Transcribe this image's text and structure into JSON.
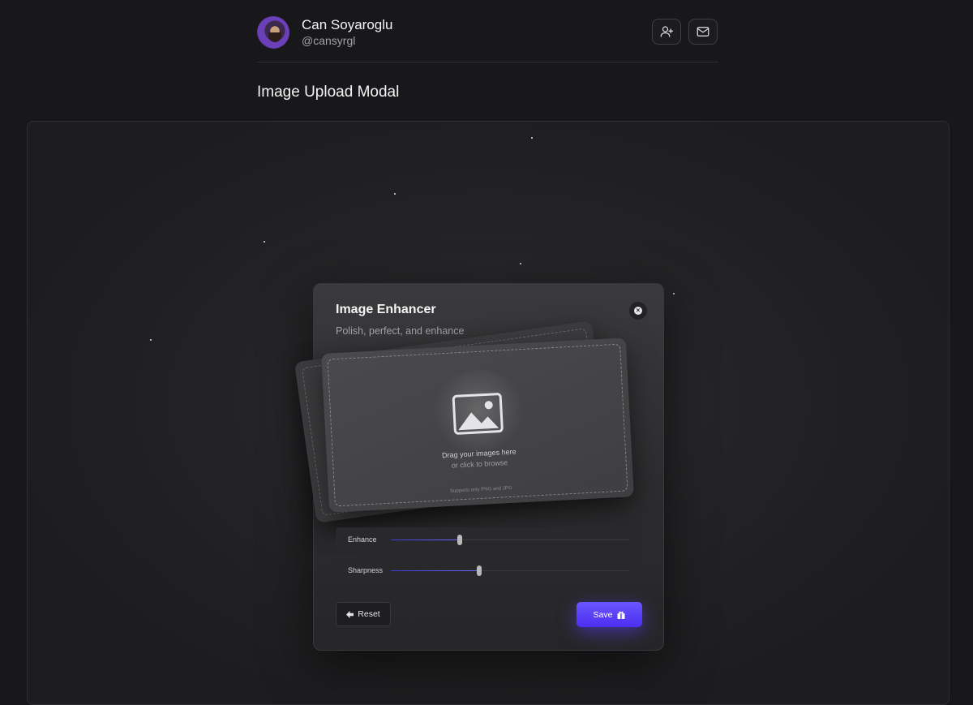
{
  "author": {
    "name": "Can Soyaroglu",
    "handle": "@cansyrgl"
  },
  "header_actions": {
    "follow_icon": "user-plus-icon",
    "mail_icon": "mail-icon"
  },
  "page": {
    "title": "Image Upload Modal"
  },
  "modal": {
    "title": "Image Enhancer",
    "subtitle": "Polish, perfect, and enhance",
    "close_icon": "close-circle-icon",
    "dropzone": {
      "icon": "image-icon",
      "primary_text": "Drag your images here",
      "secondary_text": "or click to browse",
      "note": "Supports only PNG and JPG"
    },
    "sliders": [
      {
        "label": "Enhance",
        "value": 0.29
      },
      {
        "label": "Sharpness",
        "value": 0.37
      }
    ],
    "reset_label": "Reset",
    "reset_icon": "arrow-left-icon",
    "save_label": "Save",
    "save_icon": "gift-icon"
  },
  "colors": {
    "accent": "#5b3ff8",
    "background": "#18181b"
  }
}
